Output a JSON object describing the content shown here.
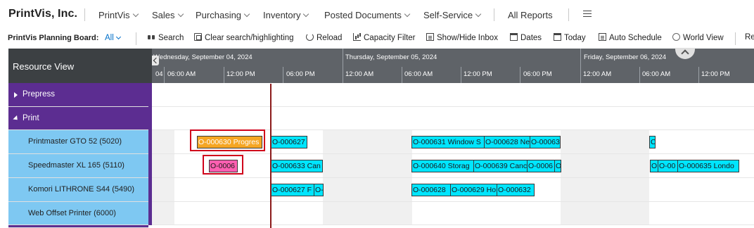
{
  "brand": "PrintVis, Inc.",
  "nav": [
    {
      "label": "PrintVis",
      "dropdown": true
    },
    {
      "label": "Sales",
      "dropdown": true
    },
    {
      "label": "Purchasing",
      "dropdown": true
    },
    {
      "label": "Inventory",
      "dropdown": true
    },
    {
      "label": "Posted Documents",
      "dropdown": true
    },
    {
      "label": "Self-Service",
      "dropdown": true
    },
    {
      "label": "All Reports",
      "dropdown": false
    }
  ],
  "toolbar": {
    "title": "PrintVis Planning Board:",
    "filter": "All",
    "buttons": [
      {
        "label": "Search",
        "icon": "binoculars-icon"
      },
      {
        "label": "Clear search/highlighting",
        "icon": "clear-icon"
      },
      {
        "label": "Reload",
        "icon": "reload-icon"
      },
      {
        "label": "Capacity Filter",
        "icon": "chart-icon"
      },
      {
        "label": "Show/Hide Inbox",
        "icon": "inbox-icon"
      },
      {
        "label": "Dates",
        "icon": "calendar-icon"
      },
      {
        "label": "Today",
        "icon": "today-icon"
      },
      {
        "label": "Auto Schedule",
        "icon": "schedule-icon"
      },
      {
        "label": "World View",
        "icon": "globe-icon"
      },
      {
        "label": "Re",
        "icon": ""
      }
    ]
  },
  "board": {
    "resource_view_label": "Resource View",
    "days": [
      {
        "label": "Wednesday, September 04, 2024"
      },
      {
        "label": "Thursday, September 05, 2024"
      },
      {
        "label": "Friday, September 06, 2024"
      }
    ],
    "hours": [
      "04",
      "06:00 AM",
      "12:00 PM",
      "06:00 PM",
      "12:00 AM",
      "06:00 AM",
      "12:00 PM",
      "06:00 PM",
      "12:00 AM",
      "06:00 AM",
      "12:00 PM"
    ],
    "groups": [
      {
        "label": "Prepress",
        "expanded": false
      },
      {
        "label": "Print",
        "expanded": true
      }
    ],
    "resources": [
      {
        "label": "Printmaster GTO 52 (5020)"
      },
      {
        "label": "Speedmaster XL 165 (5110)"
      },
      {
        "label": "Komori LITHRONE S44 (5490)"
      },
      {
        "label": "Web Offset Printer (6000)"
      }
    ],
    "jobs": {
      "r0": [
        {
          "text": "O-000630 Progres",
          "color": "orange",
          "selected": true
        },
        {
          "text": "O-000627",
          "color": "cyan"
        },
        {
          "text": "O-000631 Window S",
          "color": "cyan"
        },
        {
          "text": "O-000628 Ne",
          "color": "cyan"
        },
        {
          "text": "O-00063",
          "color": "cyan"
        },
        {
          "text": "C",
          "color": "cyan"
        }
      ],
      "r1": [
        {
          "text": "O-0006",
          "color": "pink",
          "selected": true
        },
        {
          "text": "O-000633 Can",
          "color": "cyan"
        },
        {
          "text": "O-000640 Storag",
          "color": "cyan"
        },
        {
          "text": "O-000639 Canc",
          "color": "cyan"
        },
        {
          "text": "O-0006",
          "color": "cyan"
        },
        {
          "text": "O",
          "color": "cyan"
        },
        {
          "text": "O",
          "color": "cyan"
        },
        {
          "text": "O-00",
          "color": "cyan"
        },
        {
          "text": "O-000635 Londo",
          "color": "cyan"
        }
      ],
      "r2": [
        {
          "text": "O-000627 F",
          "color": "cyan"
        },
        {
          "text": "O-",
          "color": "cyan"
        },
        {
          "text": "O-000628",
          "color": "cyan"
        },
        {
          "text": "O-000629 Ho",
          "color": "cyan"
        },
        {
          "text": "O-000632",
          "color": "cyan"
        }
      ]
    }
  }
}
